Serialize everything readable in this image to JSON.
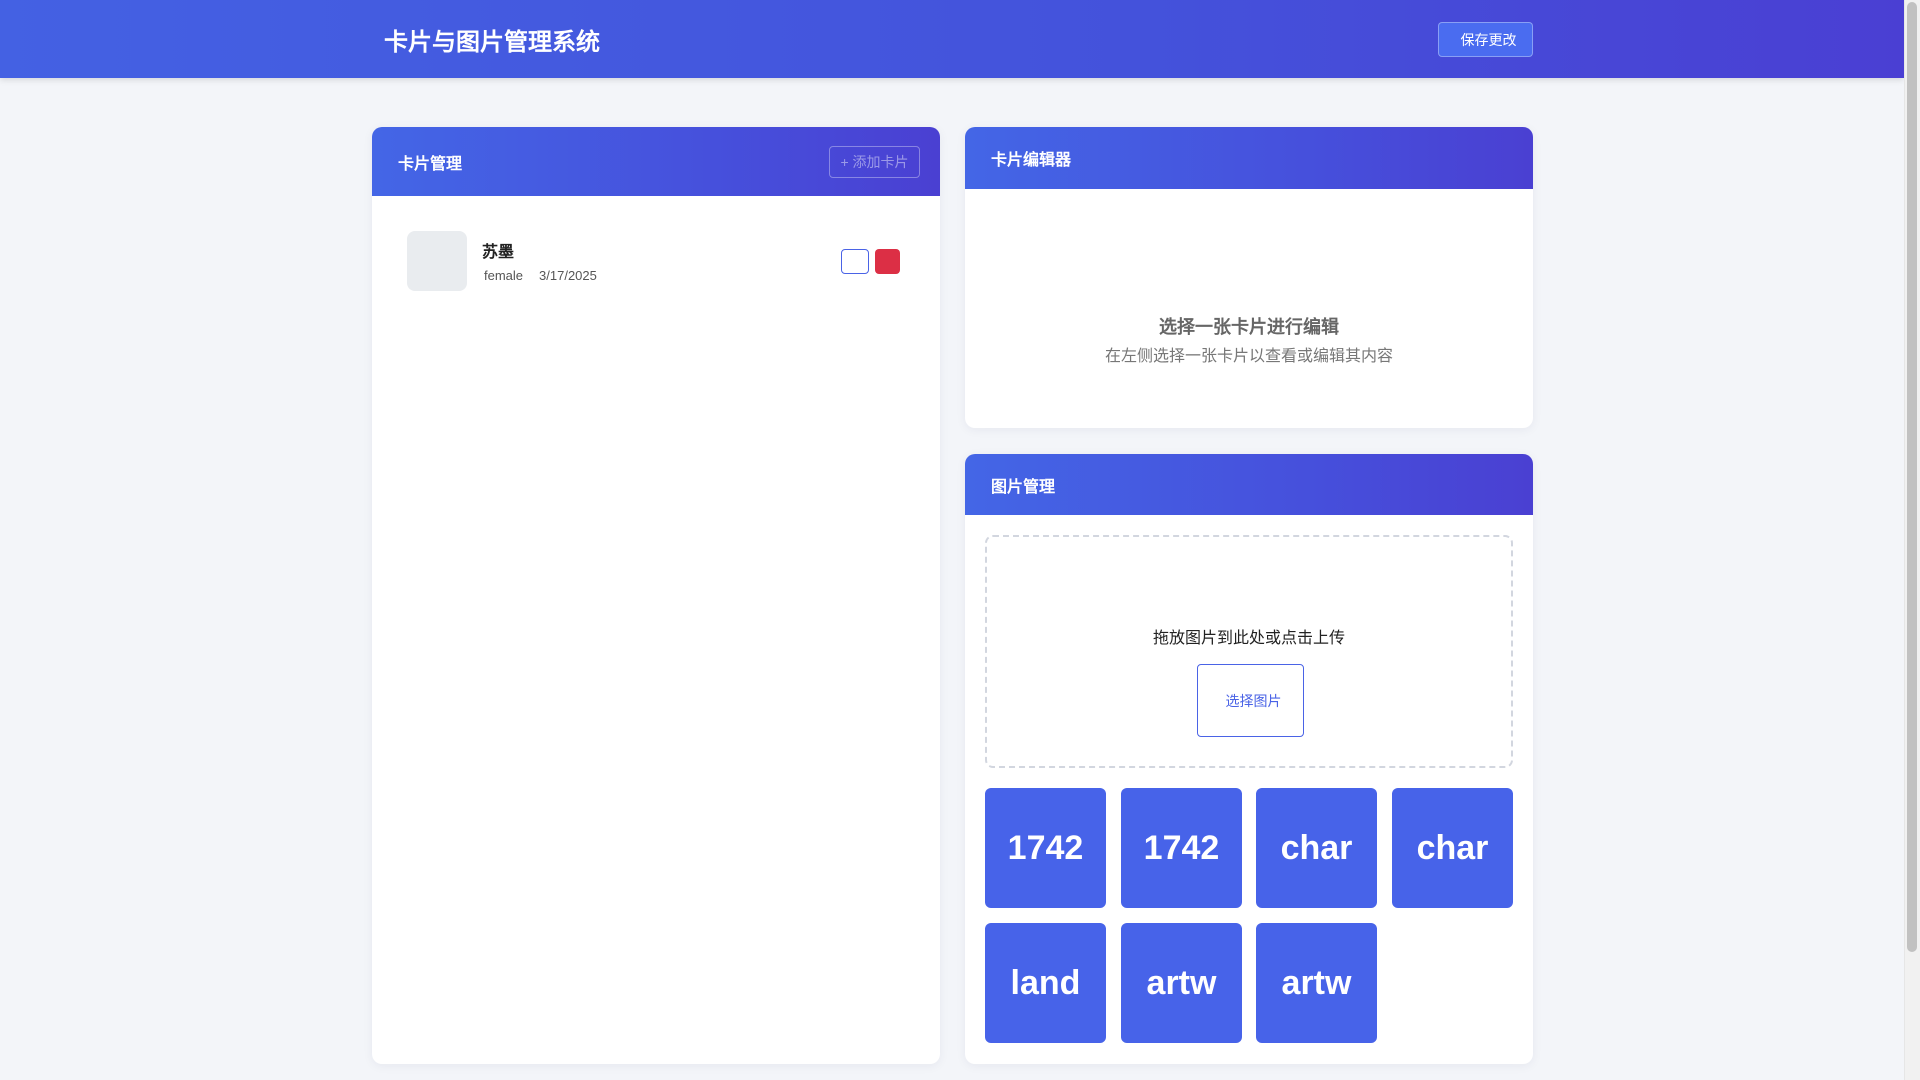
{
  "header": {
    "icon": "cards-icon",
    "icon_glyph": "",
    "title": "卡片与图片管理系统",
    "save_icon_glyph": "",
    "save_label": "保存更改"
  },
  "cards_panel": {
    "icon_glyph": "",
    "title": "卡片管理",
    "add_label": "+ 添加卡片",
    "cards": [
      {
        "avatar_glyph": "",
        "name": "苏墨",
        "gender_icon_glyph": "",
        "gender": "female",
        "date_icon_glyph": "",
        "date": "3/17/2025",
        "edit_glyph": "",
        "delete_glyph": ""
      }
    ]
  },
  "editor_panel": {
    "icon_glyph": "",
    "title": "卡片编辑器",
    "empty_icon_glyph": "",
    "empty_title": "选择一张卡片进行编辑",
    "empty_subtitle": "在左侧选择一张卡片以查看或编辑其内容"
  },
  "images_panel": {
    "icon_glyph": "",
    "title": "图片管理",
    "upload_icon_glyph": "",
    "drop_text": "拖放图片到此处或点击上传",
    "choose_icon_glyph": "",
    "choose_label": "选择图片",
    "thumbnails": [
      "1742",
      "1742",
      "char",
      "char",
      "land",
      "artw",
      "artw"
    ]
  },
  "colors": {
    "primary": "#4763e9",
    "danger": "#dc2f45",
    "background": "#f3f5f9"
  }
}
